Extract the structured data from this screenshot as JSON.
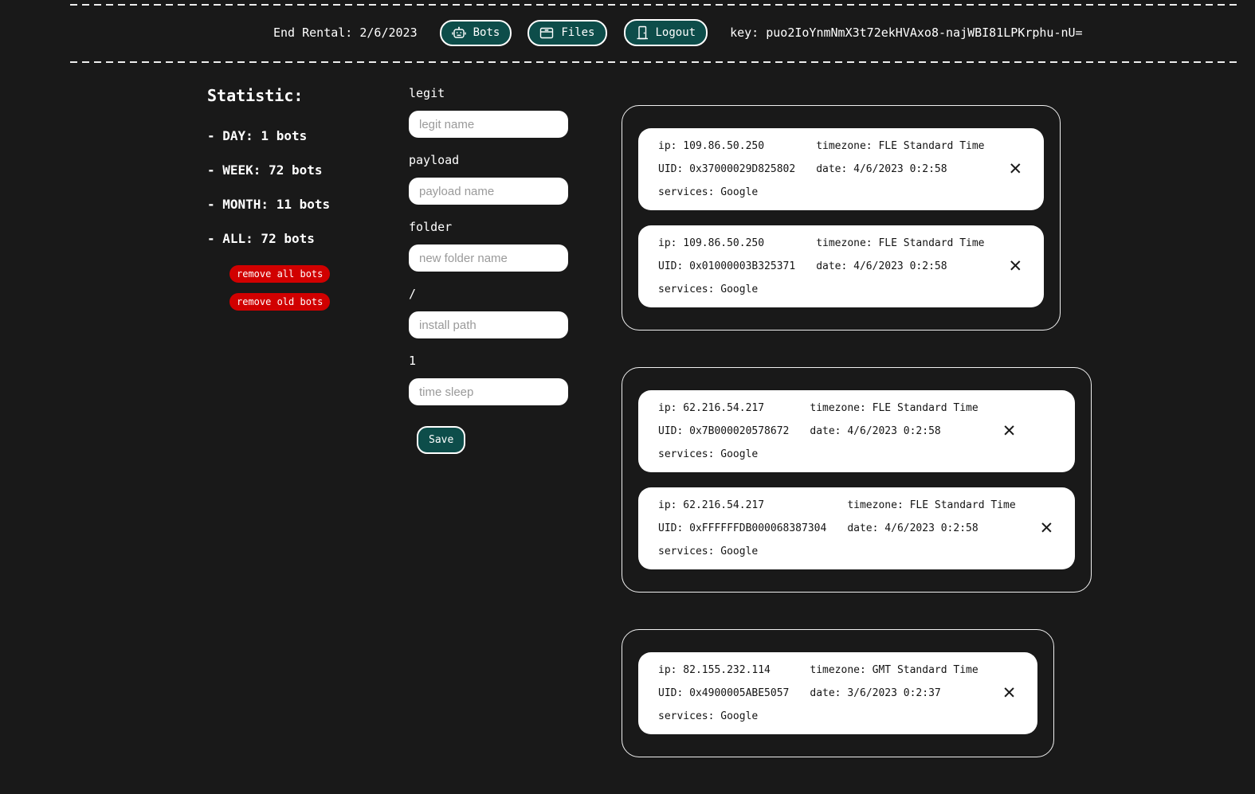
{
  "header": {
    "end_rental": "End Rental: 2/6/2023",
    "buttons": [
      {
        "id": "bots",
        "label": "Bots",
        "icon": "robot-icon"
      },
      {
        "id": "files",
        "label": "Files",
        "icon": "file-box-icon"
      },
      {
        "id": "logout",
        "label": "Logout",
        "icon": "door-icon"
      }
    ],
    "key": "key: puo2IoYnmNmX3t72ekHVAxo8-najWBI81LPKrphu-nU="
  },
  "statistics": {
    "title": "Statistic:",
    "items": [
      {
        "text": "- DAY: 1 bots"
      },
      {
        "text": "- WEEK: 72 bots"
      },
      {
        "text": "- MONTH: 11 bots"
      },
      {
        "text": "- ALL: 72 bots"
      }
    ],
    "remove_all_label": "remove all bots",
    "remove_old_label": "remove old bots"
  },
  "form": {
    "fields": [
      {
        "label": "legit",
        "placeholder": "legit name",
        "value": ""
      },
      {
        "label": "payload",
        "placeholder": "payload name",
        "value": ""
      },
      {
        "label": "folder",
        "placeholder": "new folder name",
        "value": ""
      },
      {
        "label": "/",
        "placeholder": "install path",
        "value": ""
      },
      {
        "label": "1",
        "placeholder": "time sleep",
        "value": ""
      }
    ],
    "save_label": "Save"
  },
  "bot_card_labels": {
    "ip": "ip:",
    "timezone": "timezone:",
    "uid": "UID:",
    "date": "date:",
    "services": "services:"
  },
  "bot_groups": [
    {
      "bots": [
        {
          "ip": "109.86.50.250",
          "timezone": "FLE Standard Time",
          "uid": "0x37000029D825802",
          "date": "4/6/2023 0:2:58",
          "services": "Google"
        },
        {
          "ip": "109.86.50.250",
          "timezone": "FLE Standard Time",
          "uid": "0x01000003B325371",
          "date": "4/6/2023 0:2:58",
          "services": "Google"
        }
      ]
    },
    {
      "bots": [
        {
          "ip": "62.216.54.217",
          "timezone": "FLE Standard Time",
          "uid": "0x7B000020578672",
          "date": "4/6/2023 0:2:58",
          "services": "Google"
        },
        {
          "ip": "62.216.54.217",
          "timezone": "FLE Standard Time",
          "uid": "0xFFFFFFDB000068387304",
          "date": "4/6/2023 0:2:58",
          "services": "Google"
        }
      ]
    },
    {
      "bots": [
        {
          "ip": "82.155.232.114",
          "timezone": "GMT Standard Time",
          "uid": "0x4900005ABE5057",
          "date": "3/6/2023 0:2:37",
          "services": "Google"
        }
      ]
    }
  ],
  "icons": {
    "close": "✕"
  },
  "colors": {
    "background": "#191919",
    "accent_teal": "#0d4d4a",
    "danger_red": "#d10000",
    "card_bg": "#ffffff",
    "line_white": "#ededed"
  }
}
